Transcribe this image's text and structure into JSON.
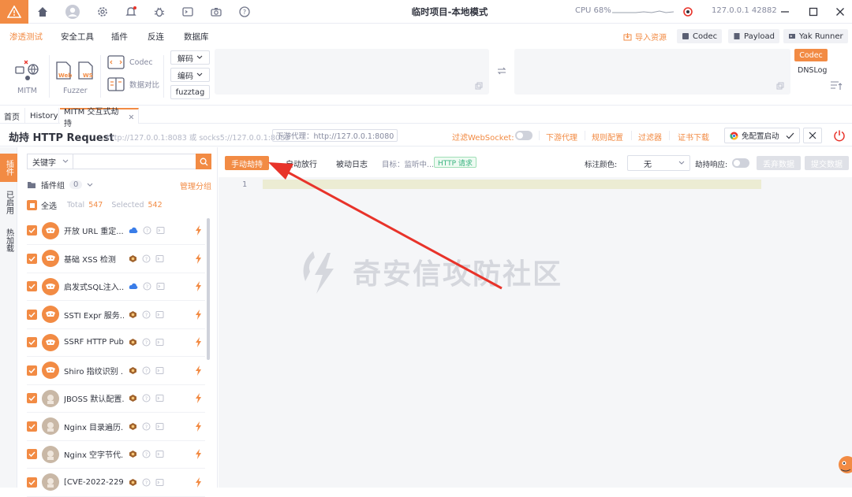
{
  "titlebar": {
    "title": "临时项目-本地模式",
    "cpu_label": "CPU 68%",
    "ip": "127.0.0.1 42882"
  },
  "menu": {
    "items": [
      "渗透测试",
      "安全工具",
      "插件",
      "反连",
      "数据库"
    ],
    "right": {
      "import": "导入资源",
      "codec": "Codec",
      "payload": "Payload",
      "yak_runner": "Yak Runner"
    }
  },
  "tools": {
    "mitm": "MITM",
    "web": "Web",
    "ws": "WS",
    "fuzzer": "Fuzzer",
    "codec": "Codec",
    "compare": "数据对比",
    "decode": "解码",
    "encode": "编码",
    "fuzztag": "fuzztag",
    "codec_btn": "Codec",
    "dnslog": "DNSLog"
  },
  "tabs": [
    "首页",
    "History",
    "MITM 交互式劫持"
  ],
  "hijack": {
    "title": "劫持 HTTP Request",
    "listen": "http://127.0.0.1:8083 或 socks5://127.0.0.1:8083",
    "downstream": "下游代理：http://127.0.0.1:8080",
    "filter_ws": "过滤WebSocket:",
    "links": [
      "下游代理",
      "规则配置",
      "过滤器",
      "证书下载"
    ],
    "no_config": "免配置启动"
  },
  "vtabs": [
    "插件",
    "已启用",
    "热加载"
  ],
  "plugin_panel": {
    "keyword": "关键字",
    "group_label": "插件组",
    "group_count": "0",
    "manage": "管理分组",
    "select_all": "全选",
    "total_label": "Total",
    "total": "547",
    "selected_label": "Selected",
    "selected": "542",
    "plugins": [
      "开放 URL 重定...",
      "基础 XSS 检测",
      "启发式SQL注入...",
      "SSTI Expr 服务...",
      "SSRF HTTP Public",
      "Shiro 指纹识别 ...",
      "JBOSS 默认配置...",
      "Nginx 目录遍历...",
      "Nginx 空字节代...",
      "[CVE-2022-2296..."
    ]
  },
  "editor": {
    "btn_manual": "手动劫持",
    "btn_auto": "自动放行",
    "btn_passive": "被动日志",
    "target": "目标：监听中...",
    "http_tag": "HTTP 请求",
    "mark_color": "标注颜色:",
    "color_value": "无",
    "hijack_response": "劫持响应:",
    "btn_discard": "丢弃数据",
    "btn_submit": "提交数据",
    "line_number": "1",
    "watermark": "奇安信攻防社区"
  },
  "colors": {
    "accent": "#f28b44",
    "arrow": "#e8332a"
  }
}
